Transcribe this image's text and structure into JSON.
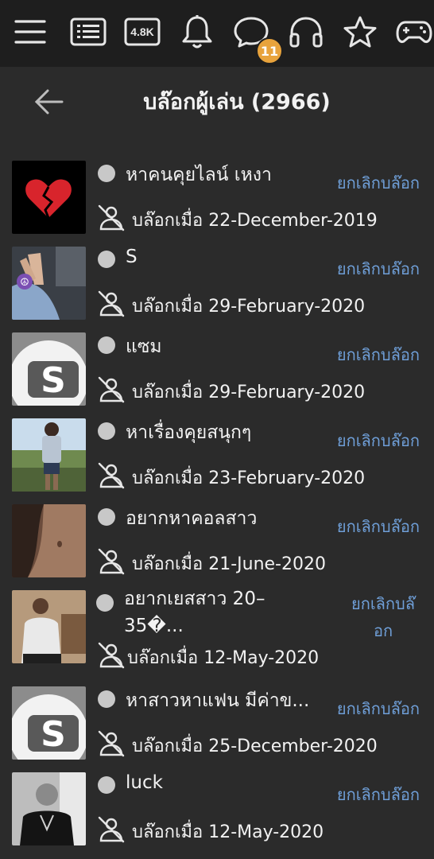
{
  "topbar": {
    "icons": [
      "menu-icon",
      "list-icon",
      "hd-icon",
      "bell-icon",
      "chat-icon",
      "headphones-icon",
      "star-icon",
      "gamepad-icon"
    ],
    "hd_label": "4.8K",
    "chat_badge": "11",
    "badge_color": "#e8a33c"
  },
  "header": {
    "title": "บล๊อกผู้เล่น (2966)"
  },
  "blocked_users": [
    {
      "name": "หาคนคุยไลน์ เหงา",
      "blocked_label": "บล๊อกเมื่อ 22-December-2019",
      "unblock_label": "ยกเลิกบล๊อก",
      "avatar": "broken-heart"
    },
    {
      "name": "S",
      "blocked_label": "บล๊อกเมื่อ 29-February-2020",
      "unblock_label": "ยกเลิกบล๊อก",
      "avatar": "photo-hand"
    },
    {
      "name": "แซม",
      "blocked_label": "บล๊อกเมื่อ 29-February-2020",
      "unblock_label": "ยกเลิกบล๊อก",
      "avatar": "default-s"
    },
    {
      "name": "หาเรื่องคุยสนุกๆ",
      "blocked_label": "บล๊อกเมื่อ 23-February-2020",
      "unblock_label": "ยกเลิกบล๊อก",
      "avatar": "photo-outdoor"
    },
    {
      "name": "อยากหาคอลสาว",
      "blocked_label": "บล๊อกเมื่อ 21-June-2020",
      "unblock_label": "ยกเลิกบล๊อก",
      "avatar": "photo-skin"
    },
    {
      "name": "อยากเยสสาว 20–35�...",
      "blocked_label": "บล๊อกเมื่อ 12-May-2020",
      "unblock_label": "ยกเลิกบล๊อก",
      "avatar": "photo-man"
    },
    {
      "name": "หาสาวหาแฟน มีค่าข...",
      "blocked_label": "บล๊อกเมื่อ 25-December-2020",
      "unblock_label": "ยกเลิกบล๊อก",
      "avatar": "default-s"
    },
    {
      "name": "luck",
      "blocked_label": "บล๊อกเมื่อ 12-May-2020",
      "unblock_label": "ยกเลิกบล๊อก",
      "avatar": "photo-dark"
    }
  ],
  "colors": {
    "background": "#2b2b2b",
    "topbar": "#1e1e1e",
    "link": "#6f9fd8",
    "status_dot": "#c8c8c8"
  }
}
